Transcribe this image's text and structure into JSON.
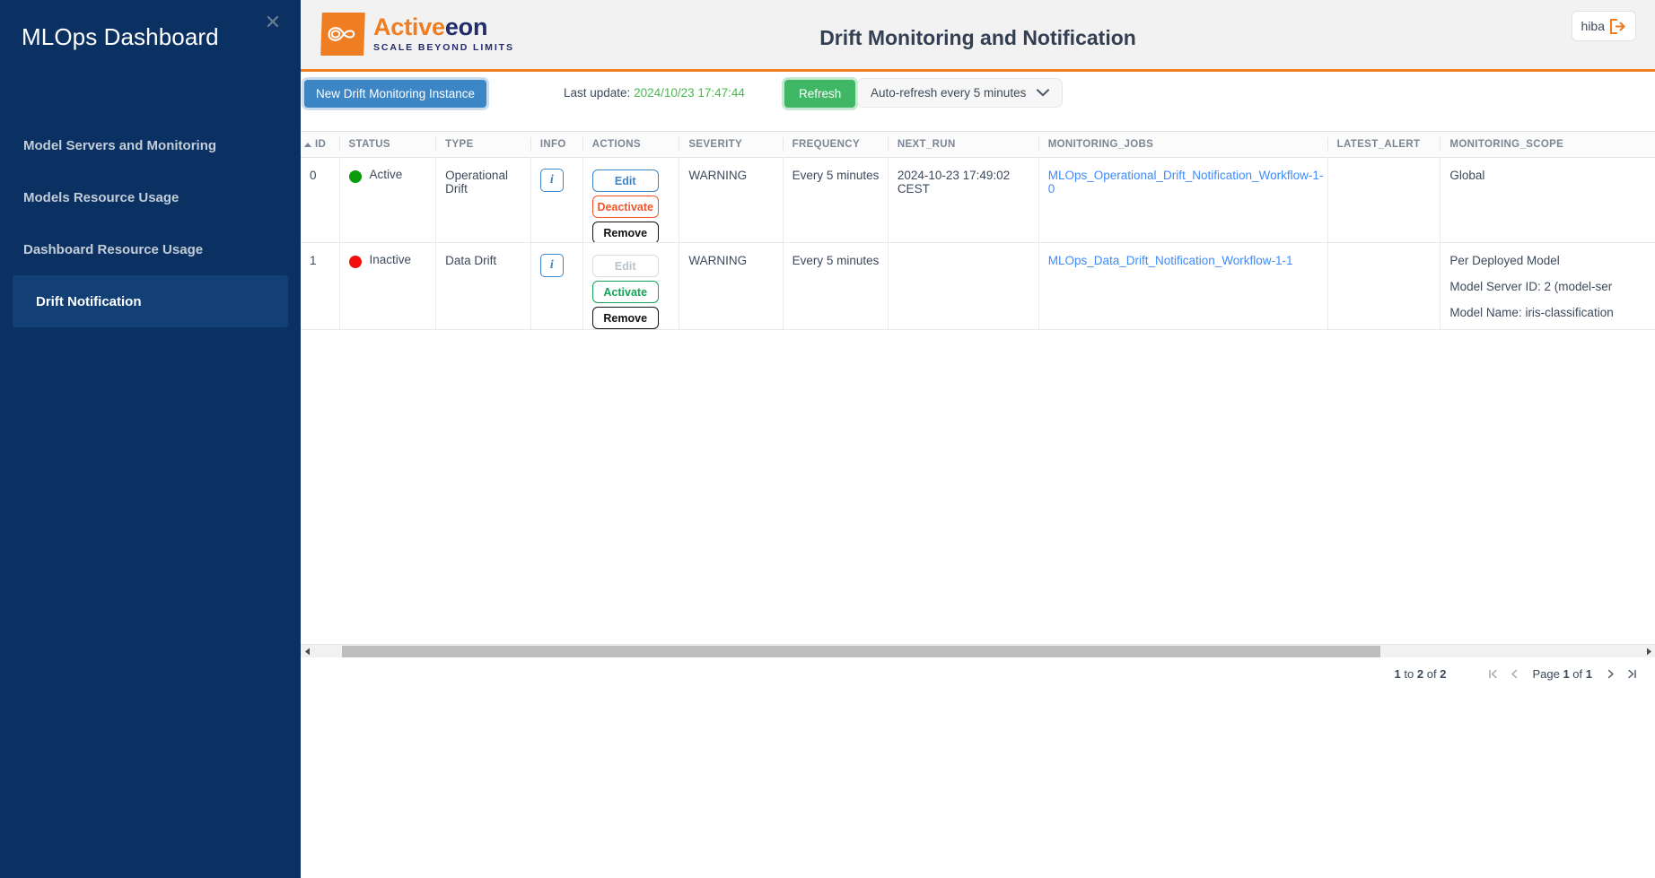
{
  "sidebar": {
    "title": "MLOps Dashboard",
    "close_icon": "close-icon",
    "items": [
      {
        "label": "Model Servers and Monitoring",
        "active": false
      },
      {
        "label": "Models Resource Usage",
        "active": false
      },
      {
        "label": "Dashboard Resource Usage",
        "active": false
      },
      {
        "label": "Drift Notification",
        "active": true
      }
    ]
  },
  "header": {
    "logo_word_1": "Active",
    "logo_word_2": "eon",
    "logo_tagline": "SCALE BEYOND LIMITS",
    "title": "Drift Monitoring and Notification",
    "user": "hiba",
    "logout_icon": "logout-icon",
    "accent_color": "#ef7d22"
  },
  "toolbar": {
    "new_instance_label": "New Drift Monitoring Instance",
    "last_update_label": "Last update:",
    "last_update_value": "2024/10/23 17:47:44",
    "refresh_label": "Refresh",
    "auto_refresh_selected": "Auto-refresh every 5 minutes",
    "chevron_icon": "chevron-down-icon",
    "new_button_color": "#3d86c6",
    "refresh_button_color": "#3fb765",
    "timestamp_color": "#4ab94f"
  },
  "table": {
    "columns": [
      "ID",
      "STATUS",
      "TYPE",
      "INFO",
      "ACTIONS",
      "SEVERITY",
      "FREQUENCY",
      "NEXT_RUN",
      "MONITORING_JOBS",
      "LATEST_ALERT",
      "MONITORING_SCOPE"
    ],
    "sort_column": "ID",
    "rows": [
      {
        "id": "0",
        "status": "Active",
        "status_color": "#0a9b0a",
        "type": "Operational Drift",
        "info_icon": "info-icon",
        "actions": [
          {
            "label": "Edit",
            "style": "edit",
            "disabled": false
          },
          {
            "label": "Deactivate",
            "style": "deactivate",
            "disabled": false
          },
          {
            "label": "Remove",
            "style": "remove",
            "disabled": false
          }
        ],
        "severity": "WARNING",
        "frequency": "Every 5 minutes",
        "next_run": "2024-10-23 17:49:02 CEST",
        "monitoring_jobs": "MLOps_Operational_Drift_Notification_Workflow-1-0",
        "latest_alert": "",
        "monitoring_scope": [
          "Global"
        ]
      },
      {
        "id": "1",
        "status": "Inactive",
        "status_color": "#f40f0f",
        "type": "Data Drift",
        "info_icon": "info-icon",
        "actions": [
          {
            "label": "Edit",
            "style": "edit",
            "disabled": true
          },
          {
            "label": "Activate",
            "style": "activate",
            "disabled": false
          },
          {
            "label": "Remove",
            "style": "remove",
            "disabled": false
          }
        ],
        "severity": "WARNING",
        "frequency": "Every 5 minutes",
        "next_run": "",
        "monitoring_jobs": "MLOps_Data_Drift_Notification_Workflow-1-1",
        "latest_alert": "",
        "monitoring_scope": [
          "Per Deployed Model",
          "Model Server ID: 2 (model-ser",
          "Model Name: iris-classification"
        ]
      }
    ]
  },
  "pagination": {
    "summary_prefix": "1",
    "summary_to": "to",
    "summary_mid": "2",
    "summary_of": "of",
    "summary_total": "2",
    "first_icon": "first-page-icon",
    "prev_icon": "previous-page-icon",
    "page_word": "Page",
    "page_current": "1",
    "page_of": "of",
    "page_total": "1",
    "next_icon": "next-page-icon",
    "last_icon": "last-page-icon"
  },
  "scrollbar": {
    "left_arrow_icon": "scroll-left-icon",
    "right_arrow_icon": "scroll-right-icon"
  }
}
